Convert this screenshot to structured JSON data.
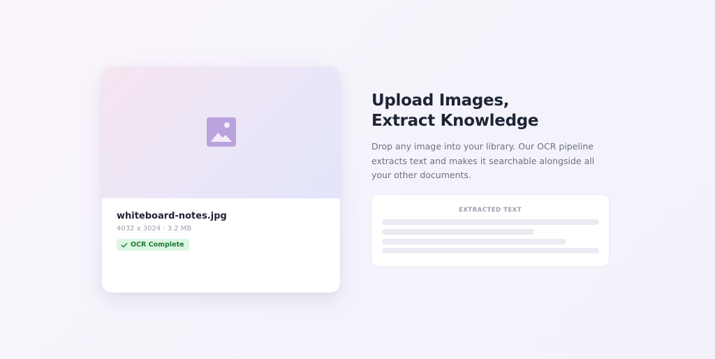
{
  "file_card": {
    "file_name": "whiteboard-notes.jpg",
    "file_meta": "4032 x 3024 · 3.2 MB",
    "status_badge": "OCR Complete",
    "preview_icon": "image-icon",
    "badge_icon": "check-icon"
  },
  "hero": {
    "title_line1": "Upload Images,",
    "title_line2": "Extract Knowledge",
    "description": "Drop any image into your library. Our OCR pipeline extracts text and makes it searchable alongside all your other documents."
  },
  "extract_panel": {
    "label": "EXTRACTED TEXT"
  },
  "colors": {
    "accent_purple": "#b9a3dc",
    "badge_bg": "#dcf6e3",
    "badge_text": "#1f7a3a",
    "heading": "#1e2535",
    "body_text": "#6b7280"
  }
}
